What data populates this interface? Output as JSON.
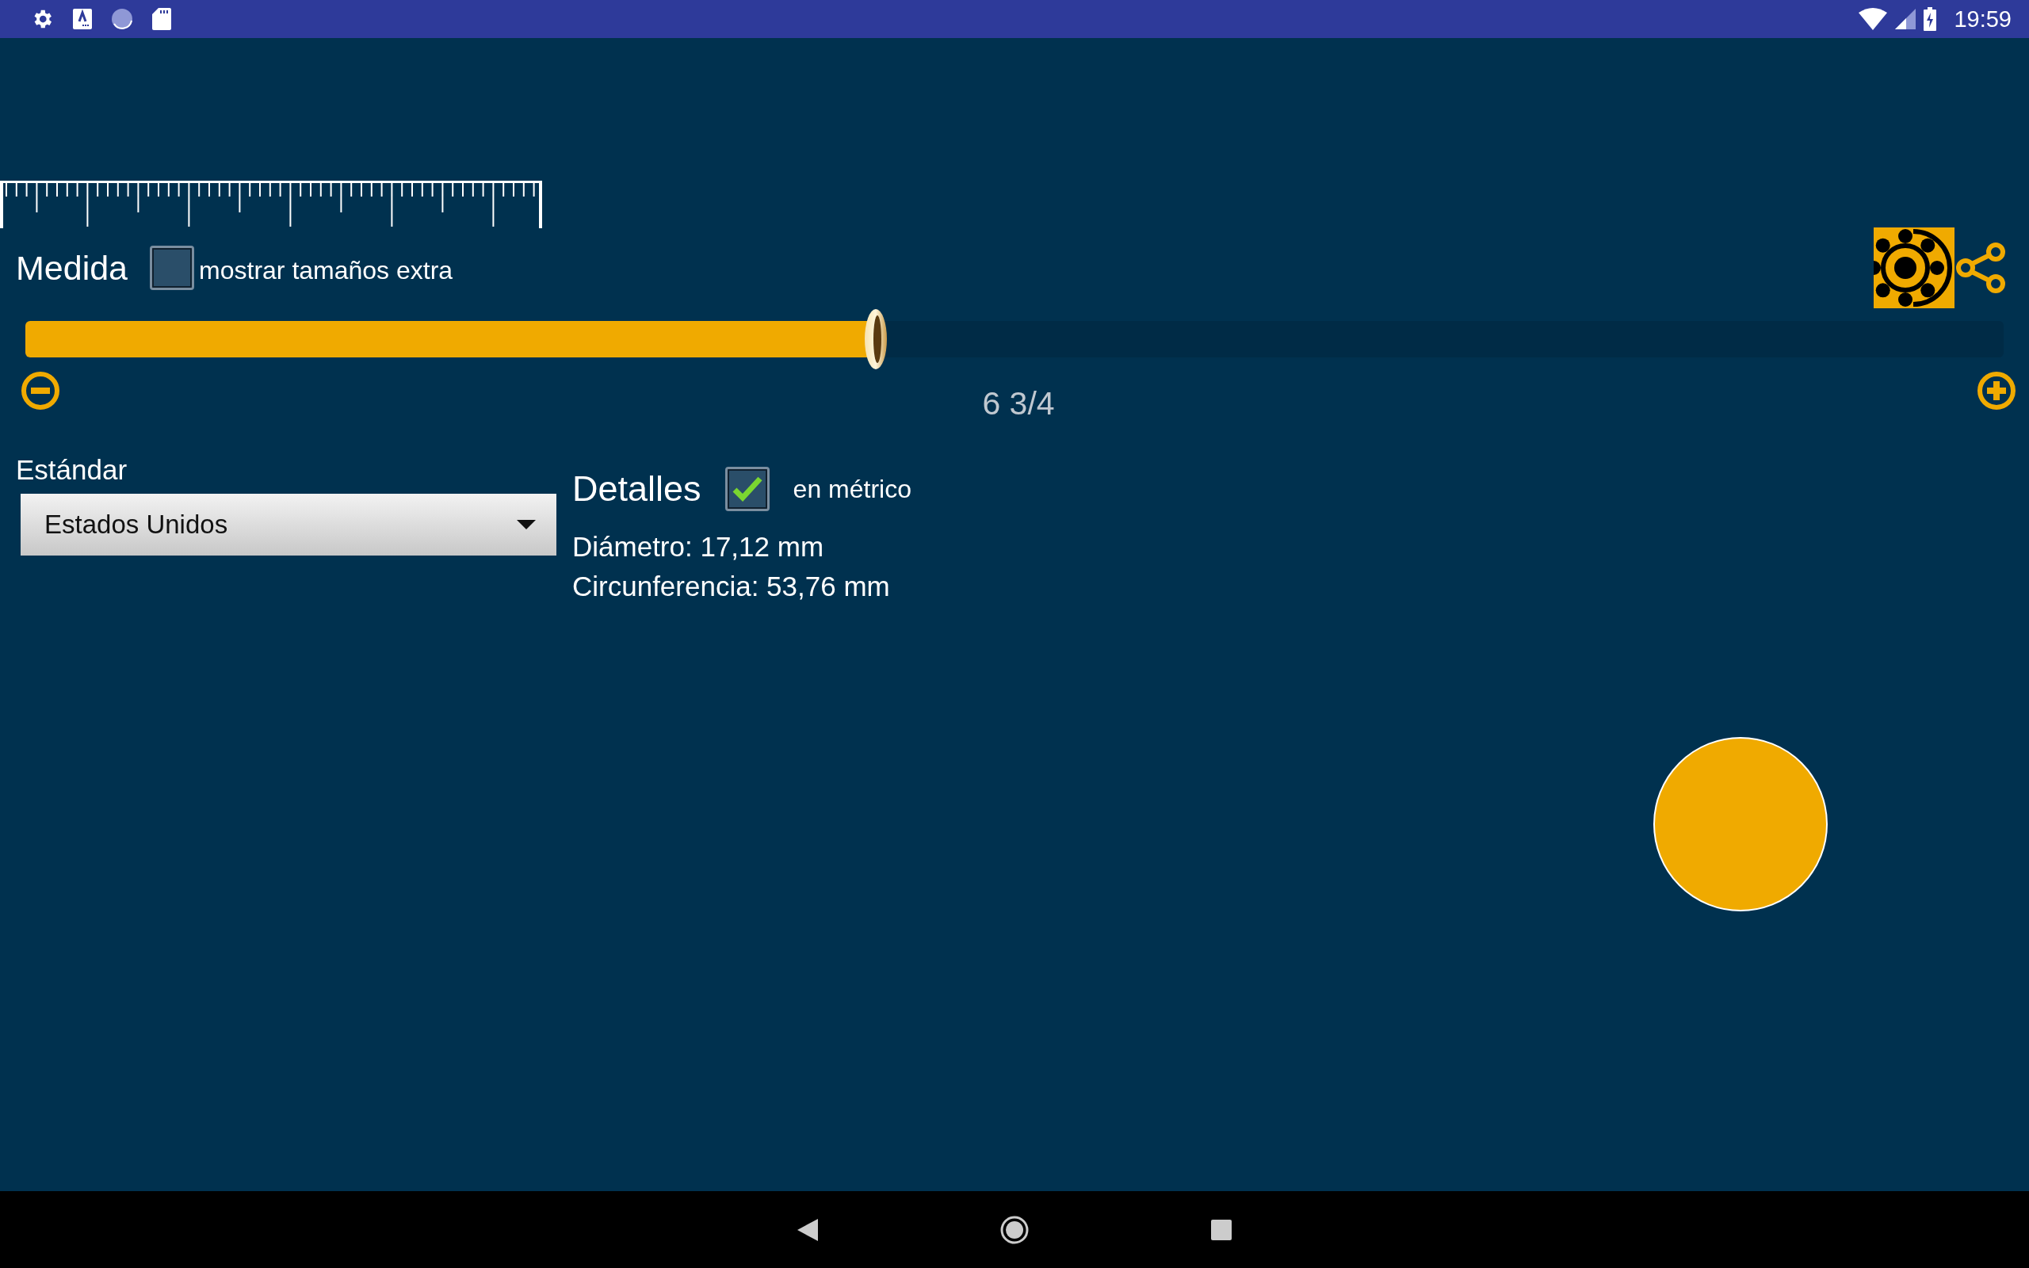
{
  "status_bar": {
    "time": "19:59"
  },
  "measure": {
    "label": "Medida",
    "extra_sizes": {
      "label": "mostrar tamaños extra",
      "checked": false
    }
  },
  "size_slider": {
    "level": 0.43,
    "value": "6 3/4"
  },
  "standard": {
    "label": "Estándar",
    "selected": "Estados Unidos"
  },
  "details": {
    "title": "Detalles",
    "metric": {
      "label": "en métrico",
      "checked": true
    },
    "lines": [
      "Diámetro: 17,12 mm",
      "Circunferencia: 53,76 mm"
    ]
  }
}
